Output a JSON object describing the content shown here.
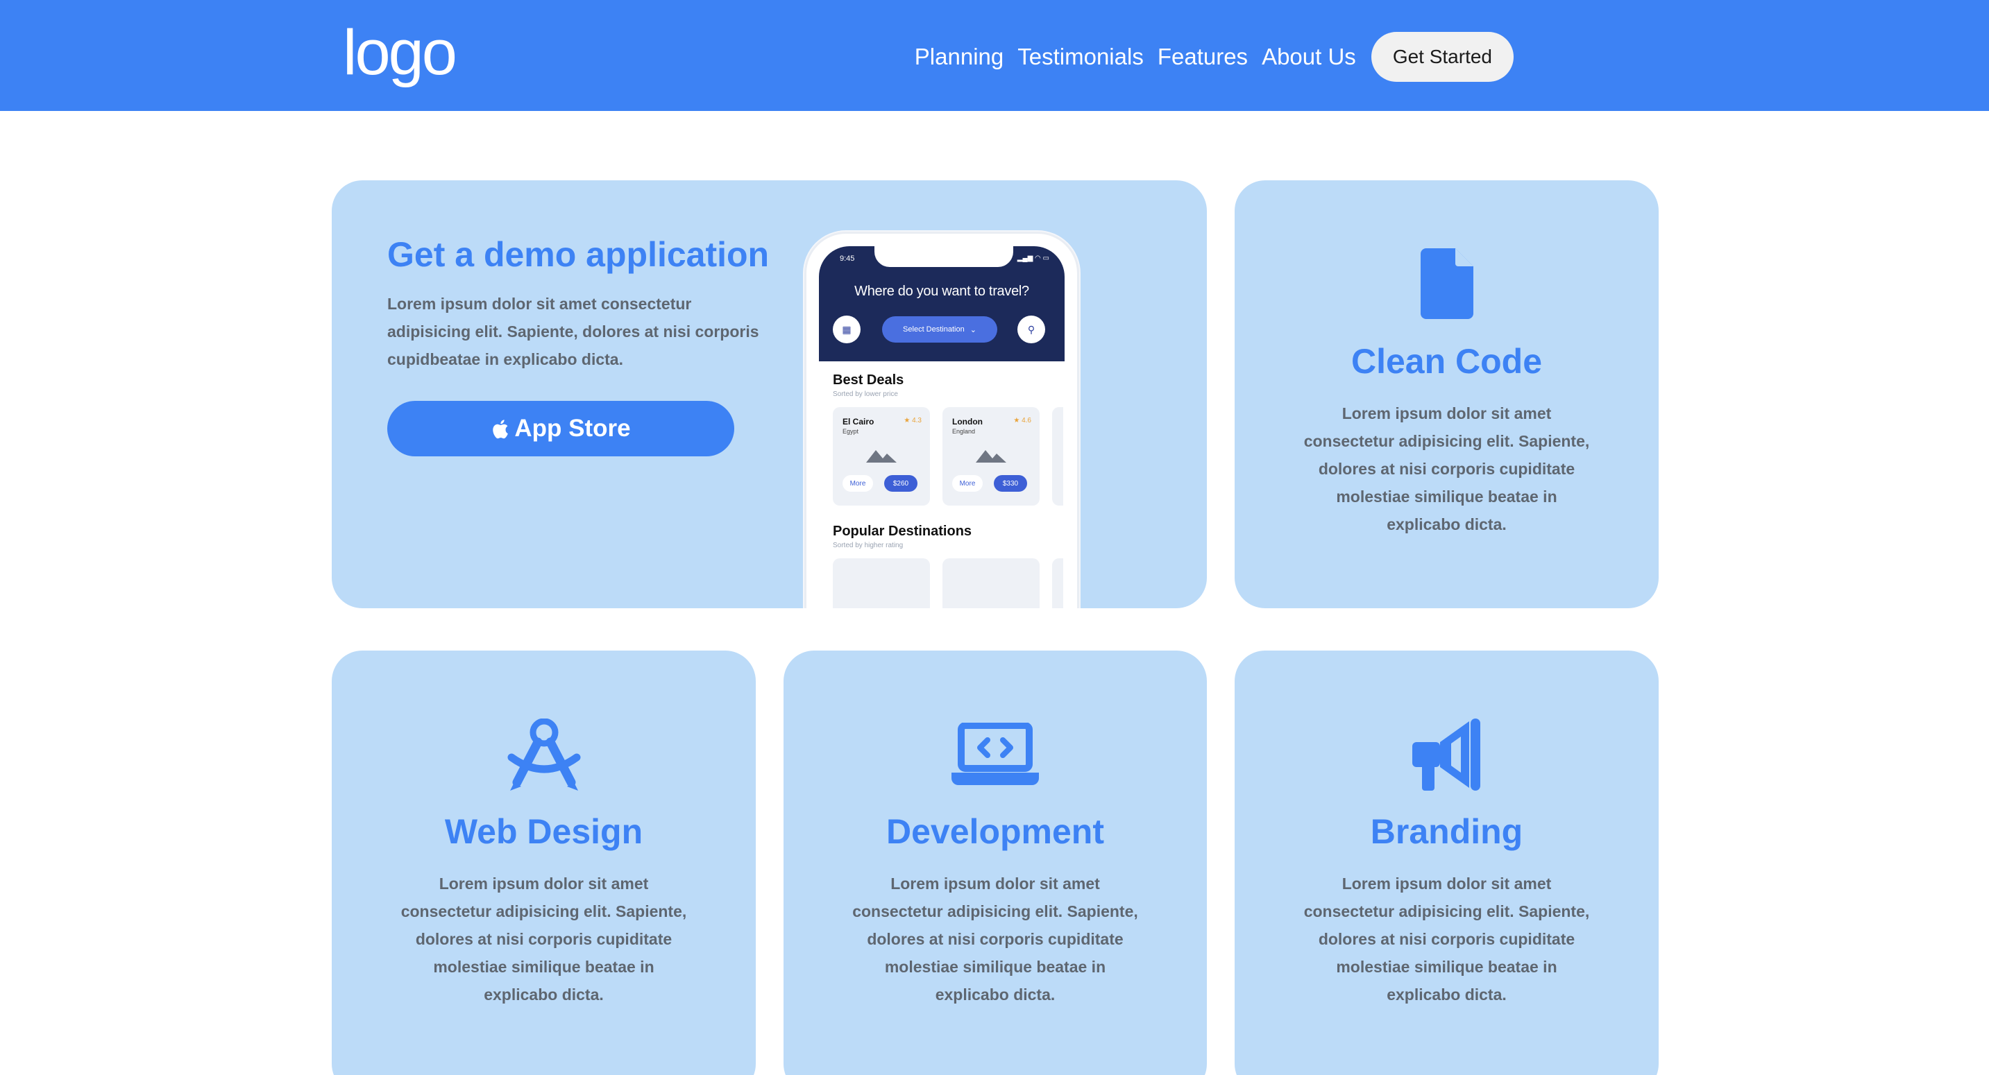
{
  "header": {
    "logo": "logo",
    "nav": [
      "Planning",
      "Testimonials",
      "Features",
      "About Us"
    ],
    "cta": "Get Started"
  },
  "demo": {
    "title": "Get a demo application",
    "text": "Lorem ipsum dolor sit amet consectetur adipisicing elit. Sapiente, dolores at nisi corporis cupidbeatae in explicabo dicta.",
    "button_label": "App Store",
    "button_icon": "apple-icon"
  },
  "phone": {
    "time": "9:45",
    "question": "Where do you want to travel?",
    "select_label": "Select Destination",
    "best_deals_title": "Best Deals",
    "best_deals_sub": "Sorted by lower price",
    "deals": [
      {
        "city": "El Cairo",
        "country": "Egypt",
        "rating": "★ 4.3",
        "more": "More",
        "price": "$260"
      },
      {
        "city": "London",
        "country": "England",
        "rating": "★ 4.6",
        "more": "More",
        "price": "$330"
      }
    ],
    "popular_title": "Popular Destinations",
    "popular_sub": "Sorted by higher rating"
  },
  "features": [
    {
      "icon": "document-icon",
      "title": "Clean Code",
      "text": "Lorem ipsum dolor sit amet consectetur adipisicing elit. Sapiente, dolores at nisi corporis cupiditate molestiae similique beatae in explicabo dicta."
    },
    {
      "icon": "compass-drafting-icon",
      "title": "Web Design",
      "text": "Lorem ipsum dolor sit amet consectetur adipisicing elit. Sapiente, dolores at nisi corporis cupiditate molestiae similique beatae in explicabo dicta."
    },
    {
      "icon": "laptop-code-icon",
      "title": "Development",
      "text": "Lorem ipsum dolor sit amet consectetur adipisicing elit. Sapiente, dolores at nisi corporis cupiditate molestiae similique beatae in explicabo dicta."
    },
    {
      "icon": "megaphone-icon",
      "title": "Branding",
      "text": "Lorem ipsum dolor sit amet consectetur adipisicing elit. Sapiente, dolores at nisi corporis cupiditate molestiae similique beatae in explicabo dicta."
    }
  ],
  "colors": {
    "brand": "#3d82f4",
    "card": "#bcdbf8",
    "text_muted": "#5e6670",
    "phone_hero": "#1c2a5a"
  }
}
